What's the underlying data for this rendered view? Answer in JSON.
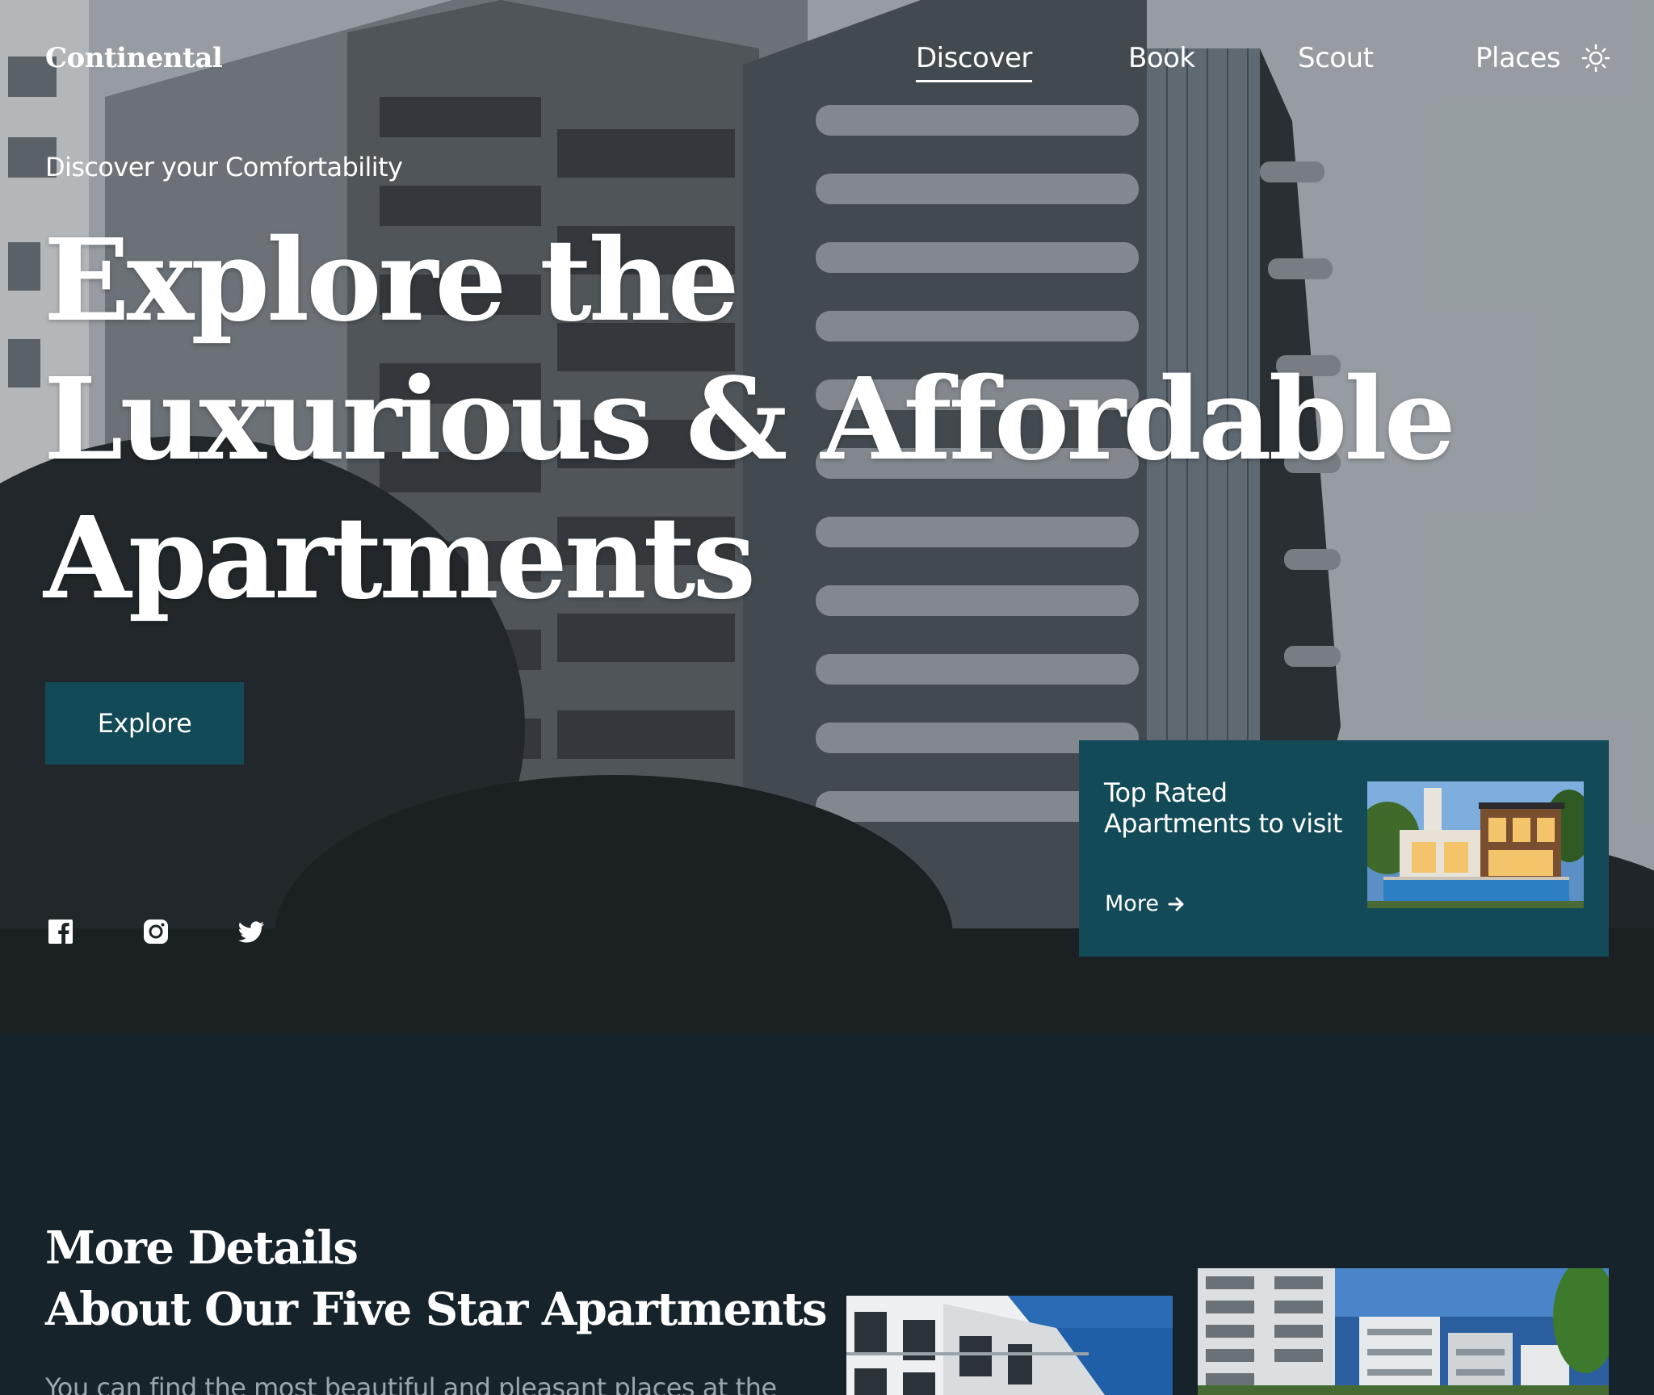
{
  "brand": {
    "logo": "Continental"
  },
  "nav": {
    "items": [
      {
        "label": "Discover",
        "active": true
      },
      {
        "label": "Book",
        "active": false
      },
      {
        "label": "Scout",
        "active": false
      },
      {
        "label": "Places",
        "active": false
      }
    ],
    "theme_icon": "sun-icon"
  },
  "hero": {
    "eyebrow": "Discover your Comfortability",
    "headline_lines": [
      "Explore the",
      "Luxurious & Affordable",
      "Apartments"
    ],
    "cta_label": "Explore",
    "social": [
      "facebook-icon",
      "instagram-icon",
      "twitter-icon"
    ]
  },
  "promo": {
    "title": "Top Rated Apartments to visit",
    "more_label": "More",
    "more_icon": "arrow-right-icon"
  },
  "details": {
    "title_lines": [
      "More Details",
      "About Our Five Star Apartments"
    ],
    "text": "You can find the most beautiful and pleasant places at the"
  },
  "colors": {
    "accent": "#134a57",
    "section_bg": "#16232a",
    "muted_text": "#9aa7ad"
  }
}
